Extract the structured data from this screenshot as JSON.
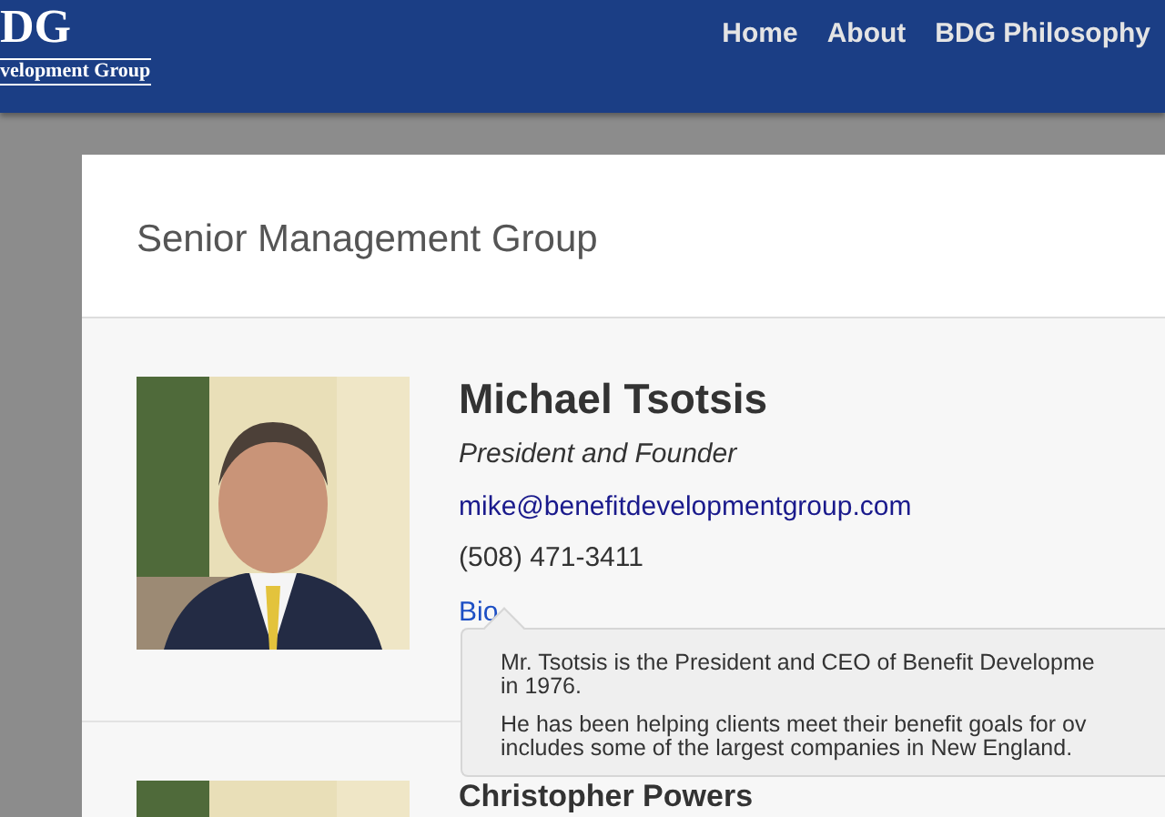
{
  "logo": {
    "letters": "DG",
    "tagline": "velopment Group"
  },
  "nav": [
    {
      "label": "Home"
    },
    {
      "label": "About"
    },
    {
      "label": "BDG Philosophy"
    }
  ],
  "section": {
    "title": "Senior Management Group"
  },
  "people": [
    {
      "name": "Michael Tsotsis",
      "title": "President and Founder",
      "email": "mike@benefitdevelopmentgroup.com",
      "phone": "(508) 471-3411",
      "bio_link": "Bio",
      "bio_popover": {
        "open": true,
        "paragraphs": [
          [
            "Mr. Tsotsis is the President and CEO of Benefit Developme",
            "in 1976."
          ],
          [
            "He has been helping clients meet their benefit goals for ov",
            "includes some of the largest companies in New England."
          ]
        ]
      }
    },
    {
      "name": "Christopher Powers"
    }
  ]
}
